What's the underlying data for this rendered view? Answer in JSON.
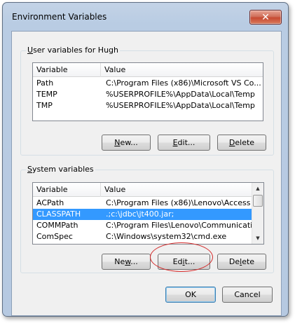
{
  "window": {
    "title": "Environment Variables",
    "close_glyph": "✕"
  },
  "user_vars": {
    "legend_prefix": "",
    "legend_accel": "U",
    "legend_rest": "ser variables for Hugh",
    "columns": [
      "Variable",
      "Value"
    ],
    "rows": [
      {
        "variable": "Path",
        "value": "C:\\Program Files (x86)\\Microsoft VS Co..."
      },
      {
        "variable": "TEMP",
        "value": "%USERPROFILE%\\AppData\\Local\\Temp"
      },
      {
        "variable": "TMP",
        "value": "%USERPROFILE%\\AppData\\Local\\Temp"
      }
    ],
    "buttons": {
      "new": {
        "accel": "N",
        "rest": "ew..."
      },
      "edit": {
        "accel": "E",
        "rest": "dit..."
      },
      "delete": {
        "accel": "D",
        "rest": "elete"
      }
    }
  },
  "system_vars": {
    "legend_accel": "S",
    "legend_rest": "ystem variables",
    "columns": [
      "Variable",
      "Value"
    ],
    "rows": [
      {
        "variable": "ACPath",
        "value": "C:\\Program Files (x86)\\Lenovo\\Access ..."
      },
      {
        "variable": "CLASSPATH",
        "value": ".;c:\\jdbc\\jt400.jar;",
        "selected": true
      },
      {
        "variable": "COMMPath",
        "value": "C:\\Program Files\\Lenovo\\Communicatio..."
      },
      {
        "variable": "ComSpec",
        "value": "C:\\Windows\\system32\\cmd.exe"
      }
    ],
    "buttons": {
      "new": {
        "before": "Ne",
        "accel": "w",
        "rest": "..."
      },
      "edit": {
        "before": "Ed",
        "accel": "i",
        "rest": "t..."
      },
      "delete": {
        "before": "De",
        "accel": "l",
        "rest": "ete"
      }
    }
  },
  "footer": {
    "ok_label": "OK",
    "cancel_label": "Cancel"
  },
  "colors": {
    "selection": "#3399ff",
    "annotation": "#d42a2a"
  }
}
